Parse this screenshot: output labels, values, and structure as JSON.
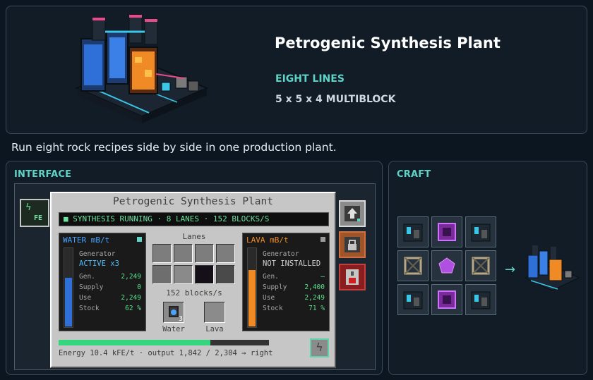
{
  "header": {
    "title": "Petrogenic Synthesis Plant",
    "subtitle": "EIGHT LINES",
    "size": "5 x 5 x 4 MULTIBLOCK"
  },
  "description": "Run eight rock recipes side by side in one production plant.",
  "sections": {
    "interface": "INTERFACE",
    "craft": "CRAFT"
  },
  "gui": {
    "title": "Petrogenic Synthesis Plant",
    "status": "■ SYNTHESIS RUNNING · 8 LANES · 152 BLOCKS/S",
    "fe_label": "FE",
    "water": {
      "name": "WATER mB/t",
      "generator_label": "Generator",
      "generator_value": "ACTIVE x3",
      "rows": [
        {
          "label": "Gen.",
          "value": "2,249"
        },
        {
          "label": "Supply",
          "value": "0"
        },
        {
          "label": "Use",
          "value": "2,249"
        },
        {
          "label": "Stock",
          "value": "62 %"
        }
      ],
      "stock_level": 0.62
    },
    "lava": {
      "name": "LAVA mB/t",
      "generator_label": "Generator",
      "generator_value": "NOT INSTALLED",
      "rows": [
        {
          "label": "Gen.",
          "value": "—"
        },
        {
          "label": "Supply",
          "value": "2,400"
        },
        {
          "label": "Use",
          "value": "2,249"
        },
        {
          "label": "Stock",
          "value": "71 %"
        }
      ],
      "stock_level": 0.71
    },
    "lanes_label": "Lanes",
    "rate": "152 blocks/s",
    "water_slot_label": "Water",
    "lava_slot_label": "Lava",
    "water_slot_count": "3",
    "energy_level": 0.72,
    "energy_text": "Energy 10.4 kFE/t · output 1,842 / 2,304 → right",
    "side_buttons": [
      "upload-icon",
      "lock-icon",
      "redstone-icon"
    ]
  },
  "craft": {
    "grid": [
      "machine",
      "plate",
      "machine",
      "frame",
      "crystal",
      "frame",
      "machine",
      "plate",
      "machine"
    ],
    "arrow": "→",
    "result": "petrogenic-synthesis-plant"
  },
  "colors": {
    "accent": "#5fd3c6",
    "water": "#2f6fd8",
    "lava": "#f08a24",
    "energy": "#35d67e",
    "status_text": "#6fe0a0"
  }
}
